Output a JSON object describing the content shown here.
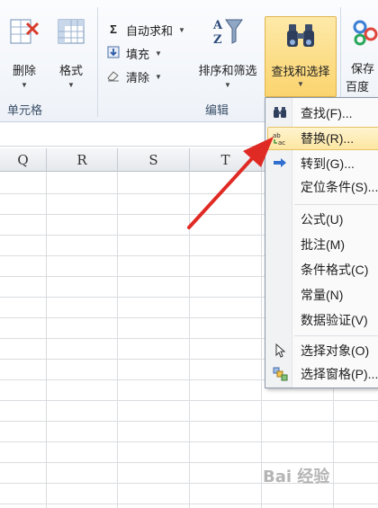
{
  "ribbon": {
    "cells_group": {
      "label": "单元格",
      "delete_label": "删除",
      "format_label": "格式"
    },
    "edit_group": {
      "label": "编辑",
      "autosum_label": "自动求和",
      "fill_label": "填充",
      "clear_label": "清除",
      "sort_filter_label": "排序和筛选",
      "find_select_label": "查找和选择"
    },
    "right_partial": {
      "line1": "保存",
      "line2": "百度"
    }
  },
  "columns": [
    "Q",
    "R",
    "S",
    "T"
  ],
  "menu": {
    "items": [
      {
        "label": "查找(F)...",
        "icon": "binoculars-icon"
      },
      {
        "label": "替换(R)...",
        "icon": "replace-icon"
      },
      {
        "label": "转到(G)...",
        "icon": "arrow-right-icon"
      },
      {
        "label": "定位条件(S)...",
        "icon": ""
      },
      {
        "label": "公式(U)",
        "icon": ""
      },
      {
        "label": "批注(M)",
        "icon": ""
      },
      {
        "label": "条件格式(C)",
        "icon": ""
      },
      {
        "label": "常量(N)",
        "icon": ""
      },
      {
        "label": "数据验证(V)",
        "icon": ""
      },
      {
        "label": "选择对象(O)",
        "icon": "cursor-icon"
      },
      {
        "label": "选择窗格(P)...",
        "icon": "selection-pane-icon"
      }
    ],
    "highlighted_index": 1
  },
  "watermark": "Bai 经验"
}
